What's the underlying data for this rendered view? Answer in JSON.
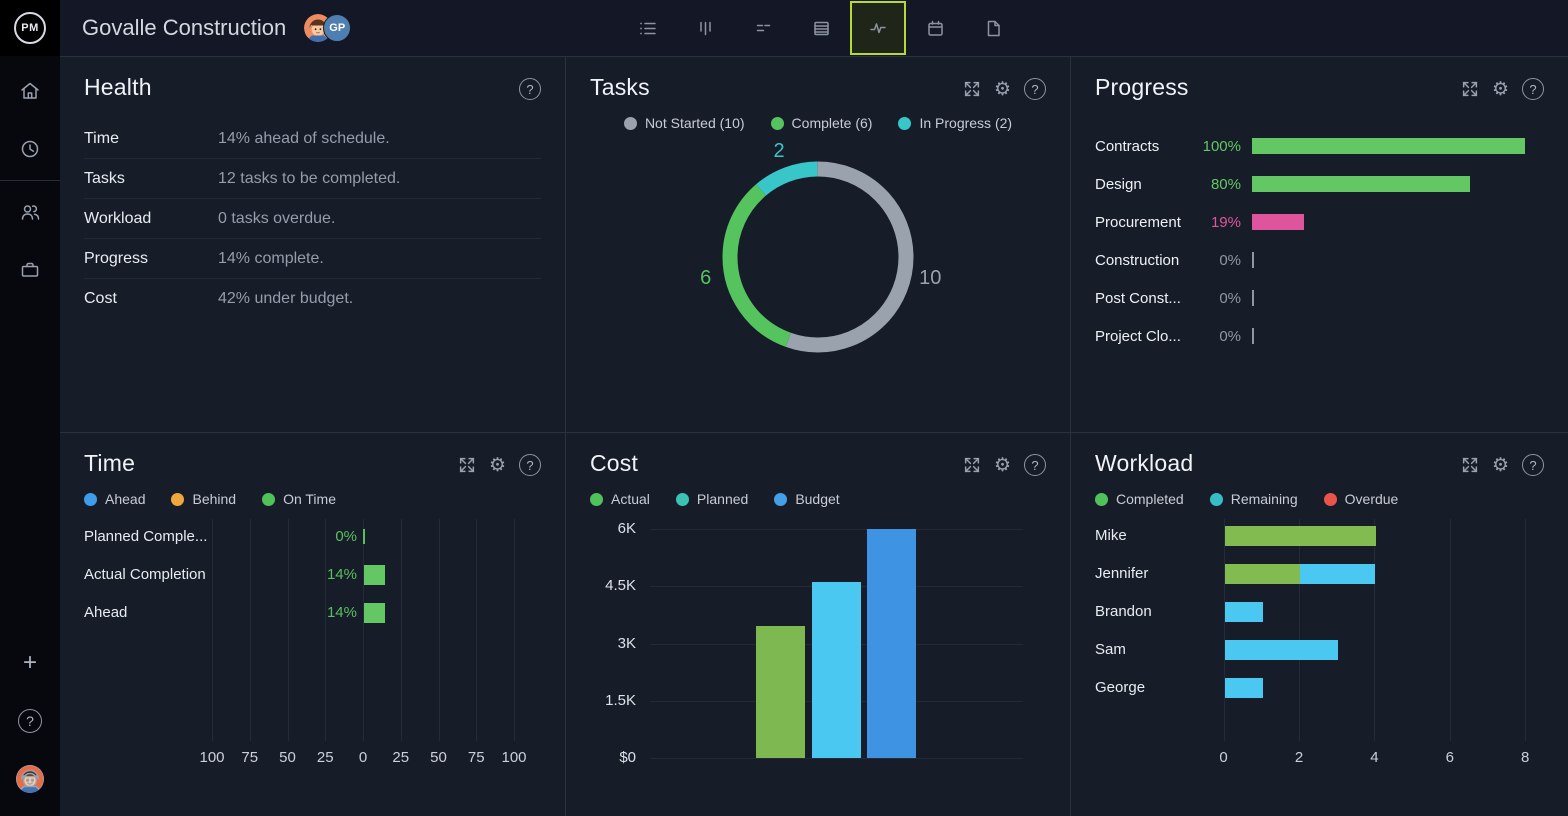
{
  "header": {
    "logo_text": "PM",
    "project_title": "Govalle Construction",
    "avatar_initials": "GP",
    "selected_accent": "#b8d837",
    "toolbar": [
      {
        "name": "list-view",
        "selected": false
      },
      {
        "name": "board-view",
        "selected": false
      },
      {
        "name": "gantt-view",
        "selected": false
      },
      {
        "name": "table-view",
        "selected": false
      },
      {
        "name": "dashboard-view",
        "selected": true
      },
      {
        "name": "calendar-view",
        "selected": false
      },
      {
        "name": "docs-view",
        "selected": false
      }
    ]
  },
  "sidebar": {
    "items": [
      "home",
      "timer",
      "team",
      "portfolio"
    ],
    "footer_plus": "+",
    "footer_help": "?"
  },
  "panel_icons": {
    "help": "?"
  },
  "panels": {
    "health": {
      "title": "Health",
      "rows": [
        {
          "label": "Time",
          "value": "14% ahead of schedule."
        },
        {
          "label": "Tasks",
          "value": "12 tasks to be completed."
        },
        {
          "label": "Workload",
          "value": "0 tasks overdue."
        },
        {
          "label": "Progress",
          "value": "14% complete."
        },
        {
          "label": "Cost",
          "value": "42% under budget."
        }
      ]
    },
    "tasks": {
      "title": "Tasks",
      "legend": [
        {
          "label": "Not Started (10)",
          "color": "#9aa2ad"
        },
        {
          "label": "Complete (6)",
          "color": "#55c45f"
        },
        {
          "label": "In Progress (2)",
          "color": "#38c6c9"
        }
      ],
      "chart_data": {
        "type": "donut",
        "segments": [
          {
            "label": "Not Started",
            "value": 10,
            "color": "#9aa2ad"
          },
          {
            "label": "Complete",
            "value": 6,
            "color": "#55c45f"
          },
          {
            "label": "In Progress",
            "value": 2,
            "color": "#38c6c9"
          }
        ]
      }
    },
    "progress": {
      "title": "Progress",
      "chart_data": {
        "type": "bar",
        "orientation": "horizontal",
        "max": 100,
        "rows": [
          {
            "label": "Contracts",
            "value": 100,
            "color": "#63c763"
          },
          {
            "label": "Design",
            "value": 80,
            "color": "#63c763"
          },
          {
            "label": "Procurement",
            "value": 19,
            "color": "#df559c"
          },
          {
            "label": "Construction",
            "value": 0,
            "color": "#8f97a3"
          },
          {
            "label": "Post Const...",
            "value": 0,
            "color": "#8f97a3"
          },
          {
            "label": "Project Clo...",
            "value": 0,
            "color": "#8f97a3"
          }
        ]
      }
    },
    "time": {
      "title": "Time",
      "legend": [
        {
          "label": "Ahead",
          "color": "#3d9deb"
        },
        {
          "label": "Behind",
          "color": "#efa63b"
        },
        {
          "label": "On Time",
          "color": "#4fc35a"
        }
      ],
      "chart_data": {
        "type": "bar",
        "orientation": "horizontal-diverging",
        "axis_ticks": [
          {
            "label": "100",
            "value": -100
          },
          {
            "label": "75",
            "value": -75
          },
          {
            "label": "50",
            "value": -50
          },
          {
            "label": "25",
            "value": -25
          },
          {
            "label": "0",
            "value": 0
          },
          {
            "label": "25",
            "value": 25
          },
          {
            "label": "50",
            "value": 50
          },
          {
            "label": "75",
            "value": 75
          },
          {
            "label": "100",
            "value": 100
          }
        ],
        "bar_color": "#63c763",
        "pct_color": "#57c15c",
        "rows": [
          {
            "label": "Planned Comple...",
            "value": 0
          },
          {
            "label": "Actual Completion",
            "value": 14
          },
          {
            "label": "Ahead",
            "value": 14
          }
        ]
      }
    },
    "cost": {
      "title": "Cost",
      "legend": [
        {
          "label": "Actual",
          "color": "#4fc35a"
        },
        {
          "label": "Planned",
          "color": "#3cc2b4"
        },
        {
          "label": "Budget",
          "color": "#449fe8"
        }
      ],
      "chart_data": {
        "type": "bar",
        "orientation": "vertical",
        "categories": [
          "Actual",
          "Planned",
          "Budget"
        ],
        "values": [
          3450,
          4600,
          6000
        ],
        "colors": [
          "#7db950",
          "#4bc8f2",
          "#3e93e2"
        ],
        "ylim": [
          0,
          6000
        ],
        "yticks": [
          {
            "label": "6K",
            "value": 6000
          },
          {
            "label": "4.5K",
            "value": 4500
          },
          {
            "label": "3K",
            "value": 3000
          },
          {
            "label": "1.5K",
            "value": 1500
          },
          {
            "label": "$0",
            "value": 0
          }
        ]
      }
    },
    "workload": {
      "title": "Workload",
      "legend": [
        {
          "label": "Completed",
          "color": "#4fc35a"
        },
        {
          "label": "Remaining",
          "color": "#35bfc4"
        },
        {
          "label": "Overdue",
          "color": "#e8544a"
        }
      ],
      "chart_data": {
        "type": "bar",
        "orientation": "horizontal-stacked",
        "xlim": [
          0,
          8
        ],
        "xticks": [
          {
            "label": "0",
            "value": 0
          },
          {
            "label": "2",
            "value": 2
          },
          {
            "label": "4",
            "value": 4
          },
          {
            "label": "6",
            "value": 6
          },
          {
            "label": "8",
            "value": 8
          }
        ],
        "series_colors": {
          "completed": "#82bb4f",
          "remaining": "#4bc8f2"
        },
        "rows": [
          {
            "label": "Mike",
            "completed": 4,
            "remaining": 0
          },
          {
            "label": "Jennifer",
            "completed": 2,
            "remaining": 2
          },
          {
            "label": "Brandon",
            "completed": 0,
            "remaining": 1
          },
          {
            "label": "Sam",
            "completed": 0,
            "remaining": 3
          },
          {
            "label": "George",
            "completed": 0,
            "remaining": 1
          }
        ]
      }
    }
  }
}
